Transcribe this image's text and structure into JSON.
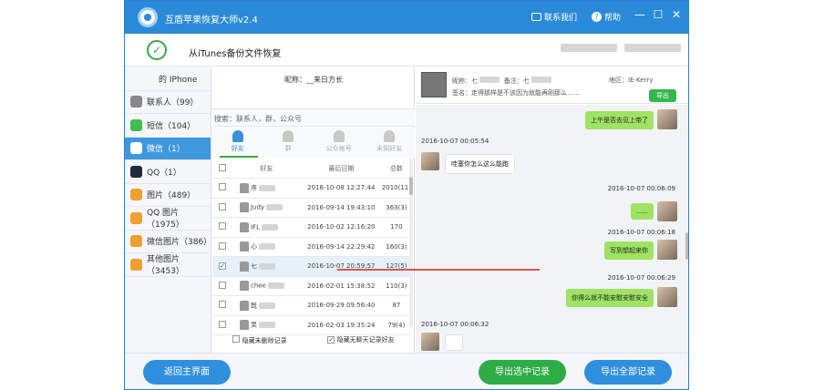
{
  "window": {
    "title": "互盾苹果恢复大师v2.4",
    "contact_us": "联系我们",
    "help": "帮助",
    "minimize": "—",
    "maximize": "☐",
    "close": "✕"
  },
  "subheader": {
    "title": "从iTunes备份文件恢复"
  },
  "sidebar": {
    "items": [
      {
        "label": "的 IPhone",
        "icon": "phone-icon",
        "color": "#f4f6f9",
        "active": false
      },
      {
        "label": "联系人（99）",
        "icon": "contacts-icon",
        "color": "#888888",
        "active": false
      },
      {
        "label": "短信（104）",
        "icon": "sms-icon",
        "color": "#3cbf4d",
        "active": false
      },
      {
        "label": "微信（1）",
        "icon": "wechat-icon",
        "color": "#ffffff",
        "active": true
      },
      {
        "label": "QQ（1）",
        "icon": "qq-icon",
        "color": "#1f2a3a",
        "active": false
      },
      {
        "label": "图片（489）",
        "icon": "photos-icon",
        "color": "#f0a030",
        "active": false
      },
      {
        "label": "QQ 图片（1975）",
        "icon": "qq-photos-icon",
        "color": "#f0a030",
        "active": false
      },
      {
        "label": "微信图片（386）",
        "icon": "wechat-photos-icon",
        "color": "#f0a030",
        "active": false
      },
      {
        "label": "其他图片（3453）",
        "icon": "other-photos-icon",
        "color": "#f0a030",
        "active": false
      }
    ]
  },
  "contacts": {
    "nickname": "昵称：__来日方长",
    "search_placeholder": "搜索：联系人，群，公众号",
    "tabs": [
      {
        "label": "好友",
        "active": true
      },
      {
        "label": "群",
        "active": false
      },
      {
        "label": "公众帐号",
        "active": false
      },
      {
        "label": "未知好友",
        "active": false
      }
    ],
    "columns": [
      "好友",
      "最后日期",
      "总数"
    ],
    "rows": [
      {
        "checked": "",
        "name": "序",
        "date": "2016-10-08 12:27:44",
        "count": "2010(11)",
        "selected": false
      },
      {
        "checked": "",
        "name": "Judy",
        "date": "2016-09-14 19:43:10",
        "count": "363(3)",
        "selected": false
      },
      {
        "checked": "",
        "name": "IFL",
        "date": "2016-10-02 12:16:20",
        "count": "170",
        "selected": false
      },
      {
        "checked": "",
        "name": "心",
        "date": "2016-09-14 22:29:42",
        "count": "160(3)",
        "selected": false
      },
      {
        "checked": "✓",
        "name": "七",
        "date": "2016-10-07 20:59:57",
        "count": "127(5)",
        "selected": true
      },
      {
        "checked": "",
        "name": "chee",
        "date": "2016-02-01 15:38:52",
        "count": "110(3)",
        "selected": false
      },
      {
        "checked": "",
        "name": "既",
        "date": "2016-09-29 09:56:40",
        "count": "87",
        "selected": false
      },
      {
        "checked": "",
        "name": "吴",
        "date": "2016-02-03 19:35:24",
        "count": "79(4)",
        "selected": false
      }
    ],
    "footer_left": "隐藏未删除记录",
    "footer_right": "隐藏无聊天记录好友",
    "footer_right_checked": "✓"
  },
  "chat": {
    "nickname": "昵称：七",
    "remark": "备注：七",
    "region": "地区：IE-Kerry",
    "signature": "签名：走得那样是不该因为就能再刚那么……",
    "export": "导出",
    "messages": [
      {
        "side": "r",
        "text": "上午是否去见上帝了"
      },
      {
        "time": "2016-10-07 00:05:54"
      },
      {
        "side": "l",
        "text": "哇塞你怎么这么能跑"
      },
      {
        "time": "2016-10-07 00:06:09"
      },
      {
        "side": "r",
        "text": "......"
      },
      {
        "time": "2016-10-07 00:06:18"
      },
      {
        "side": "r",
        "text": "写到想起来你"
      },
      {
        "time": "2016-10-07 00:06:29"
      },
      {
        "side": "r",
        "text": "你得么就不能安慰安慰安全"
      },
      {
        "time": "2016-10-07 00:06:32"
      },
      {
        "side": "l",
        "text": ""
      }
    ]
  },
  "buttons": {
    "back": "返回主界面",
    "export_selected": "导出选中记录",
    "export_all": "导出全部记录"
  },
  "colors": {
    "titlebar": "#2b8ad8",
    "active_sidebar": "#3f98de",
    "green": "#33b74b",
    "blue_button": "#2f8fdc",
    "bubble": "#9ee363"
  }
}
